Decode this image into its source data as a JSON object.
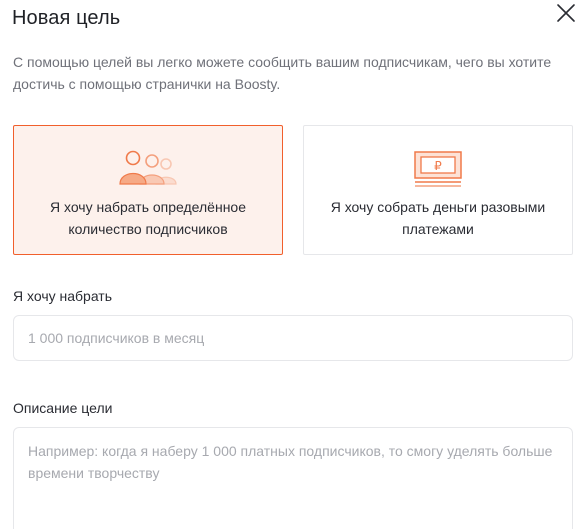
{
  "dialog": {
    "title": "Новая цель",
    "close_icon": "close-icon",
    "description": "С помощью целей вы легко можете сообщить вашим подписчикам, чего вы хотите достичь с помощью странички на Boosty."
  },
  "goal_types": [
    {
      "label": "Я хочу набрать определённое количество подписчиков",
      "icon": "subscribers-icon",
      "selected": true
    },
    {
      "label": "Я хочу собрать деньги разовыми платежами",
      "icon": "money-icon",
      "selected": false
    }
  ],
  "target": {
    "label": "Я хочу набрать",
    "value": "",
    "placeholder": "1 000 подписчиков в месяц"
  },
  "description_field": {
    "label": "Описание цели",
    "value": "",
    "placeholder": "Например: когда я наберу 1 000 платных подписчиков, то смогу уделять больше времени творчеству"
  },
  "colors": {
    "accent": "#f15f2c",
    "selected_bg": "#fdf1ec",
    "border": "#e6e7ea"
  }
}
